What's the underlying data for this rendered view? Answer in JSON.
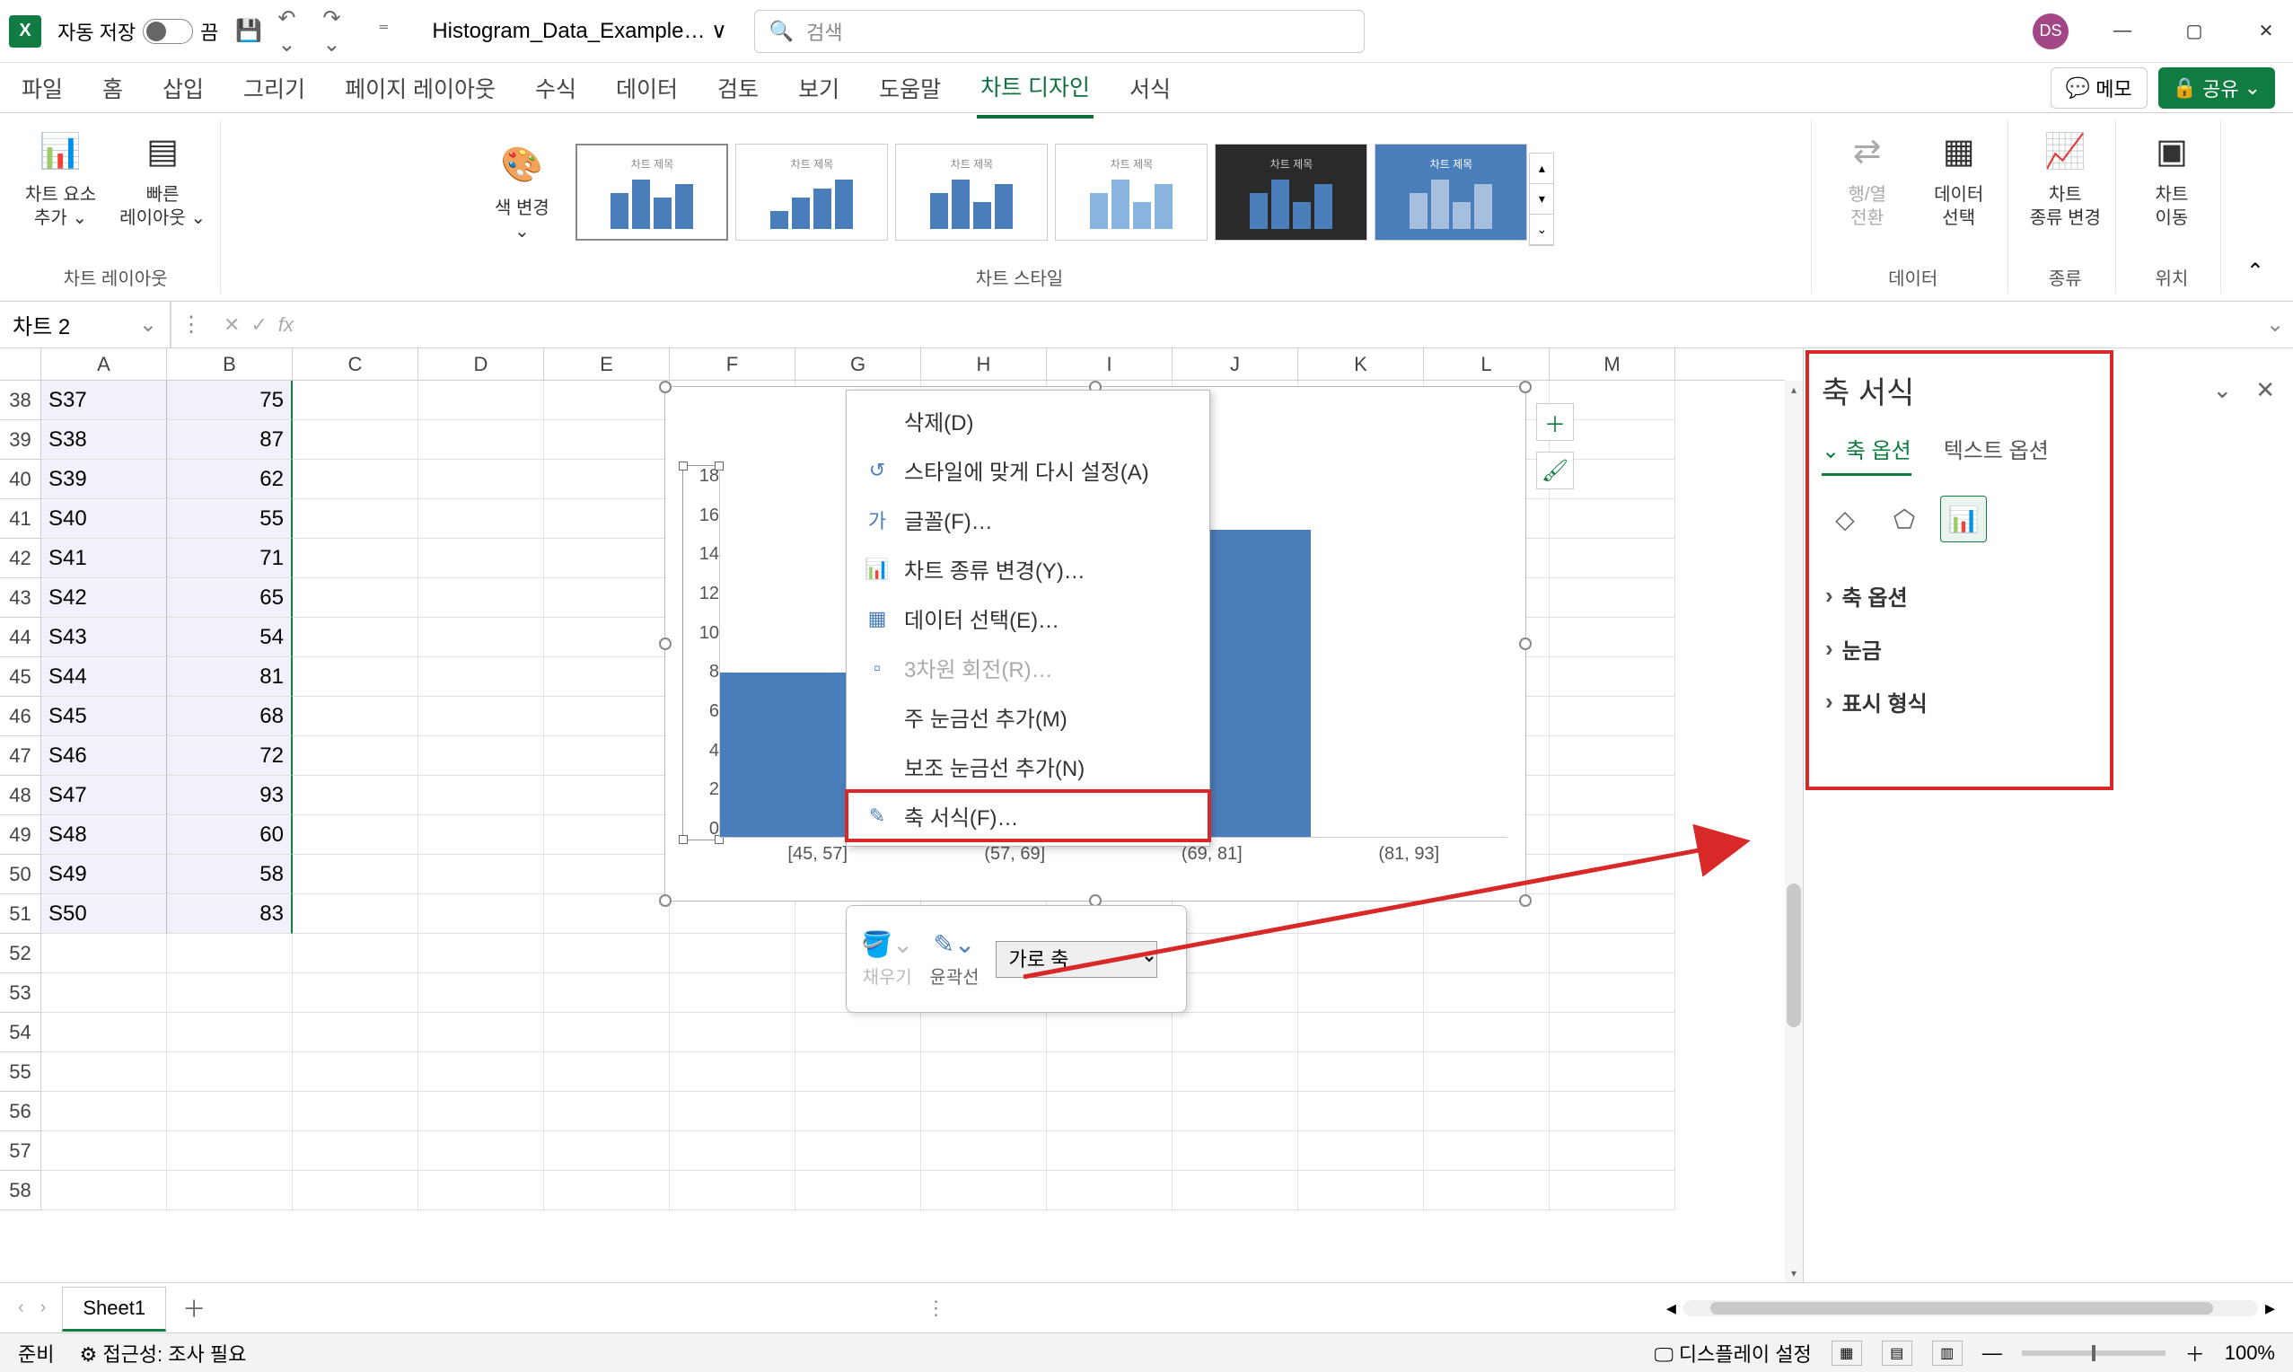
{
  "titlebar": {
    "autosave_label": "자동 저장",
    "autosave_state": "끔",
    "filename": "Histogram_Data_Example… ∨",
    "search_placeholder": "검색",
    "avatar_initials": "DS"
  },
  "ribbon_tabs": [
    "파일",
    "홈",
    "삽입",
    "그리기",
    "페이지 레이아웃",
    "수식",
    "데이터",
    "검토",
    "보기",
    "도움말",
    "차트 디자인",
    "서식"
  ],
  "ribbon_active_tab": "차트 디자인",
  "ribbon_right": {
    "memo": "메모",
    "share": "공유"
  },
  "ribbon": {
    "group_layout": {
      "label": "차트 레이아웃",
      "add_element": "차트 요소\n추가 ⌄",
      "quick_layout": "빠른\n레이아웃 ⌄"
    },
    "group_styles": {
      "label": "차트 스타일",
      "change_colors": "색 변경\n⌄",
      "style_thumb_title": "차트 제목"
    },
    "group_data": {
      "label": "데이터",
      "switch": "행/열\n전환",
      "select": "데이터\n선택"
    },
    "group_type": {
      "label": "종류",
      "change_type": "차트\n종류 변경"
    },
    "group_location": {
      "label": "위치",
      "move": "차트\n이동"
    }
  },
  "name_box": "차트 2",
  "columns": [
    "A",
    "B",
    "C",
    "D",
    "E",
    "F",
    "G",
    "H",
    "I",
    "J",
    "K",
    "L",
    "M"
  ],
  "rows": [
    {
      "n": 38,
      "a": "S37",
      "b": 75
    },
    {
      "n": 39,
      "a": "S38",
      "b": 87
    },
    {
      "n": 40,
      "a": "S39",
      "b": 62
    },
    {
      "n": 41,
      "a": "S40",
      "b": 55
    },
    {
      "n": 42,
      "a": "S41",
      "b": 71
    },
    {
      "n": 43,
      "a": "S42",
      "b": 65
    },
    {
      "n": 44,
      "a": "S43",
      "b": 54
    },
    {
      "n": 45,
      "a": "S44",
      "b": 81
    },
    {
      "n": 46,
      "a": "S45",
      "b": 68
    },
    {
      "n": 47,
      "a": "S46",
      "b": 72
    },
    {
      "n": 48,
      "a": "S47",
      "b": 93
    },
    {
      "n": 49,
      "a": "S48",
      "b": 60
    },
    {
      "n": 50,
      "a": "S49",
      "b": 58
    },
    {
      "n": 51,
      "a": "S50",
      "b": 83
    },
    {
      "n": 52,
      "a": "",
      "b": ""
    },
    {
      "n": 53,
      "a": "",
      "b": ""
    },
    {
      "n": 54,
      "a": "",
      "b": ""
    },
    {
      "n": 55,
      "a": "",
      "b": ""
    },
    {
      "n": 56,
      "a": "",
      "b": ""
    },
    {
      "n": 57,
      "a": "",
      "b": ""
    },
    {
      "n": 58,
      "a": "",
      "b": ""
    }
  ],
  "chart_data": {
    "type": "bar",
    "categories": [
      "[45, 57]",
      "(57, 69]",
      "(69, 81]",
      "(81, 93]"
    ],
    "values": [
      8,
      0,
      15,
      0
    ],
    "y_ticks": [
      18,
      16,
      14,
      12,
      10,
      8,
      6,
      4,
      2,
      0
    ],
    "ylim": [
      0,
      18
    ]
  },
  "context_menu": {
    "items": [
      {
        "label": "삭제(D)",
        "icon": ""
      },
      {
        "label": "스타일에 맞게 다시 설정(A)",
        "icon": "↺"
      },
      {
        "label": "글꼴(F)…",
        "icon": "가"
      },
      {
        "label": "차트 종류 변경(Y)…",
        "icon": "📊"
      },
      {
        "label": "데이터 선택(E)…",
        "icon": "▦"
      },
      {
        "label": "3차원 회전(R)…",
        "icon": "▫",
        "disabled": true
      },
      {
        "label": "주 눈금선 추가(M)",
        "icon": ""
      },
      {
        "label": "보조 눈금선 추가(N)",
        "icon": ""
      },
      {
        "label": "축 서식(F)…",
        "icon": "✎",
        "highlight": true
      }
    ]
  },
  "mini_toolbar": {
    "fill": "채우기",
    "outline": "윤곽선",
    "selector": "가로 축"
  },
  "format_pane": {
    "title": "축 서식",
    "tab_axis": "축 옵션",
    "tab_text": "텍스트 옵션",
    "sections": [
      "축 옵션",
      "눈금",
      "표시 형식"
    ]
  },
  "sheet_tabs": {
    "active": "Sheet1"
  },
  "status_bar": {
    "ready": "준비",
    "accessibility": "접근성: 조사 필요",
    "display": "디스플레이 설정",
    "zoom": "100%"
  }
}
